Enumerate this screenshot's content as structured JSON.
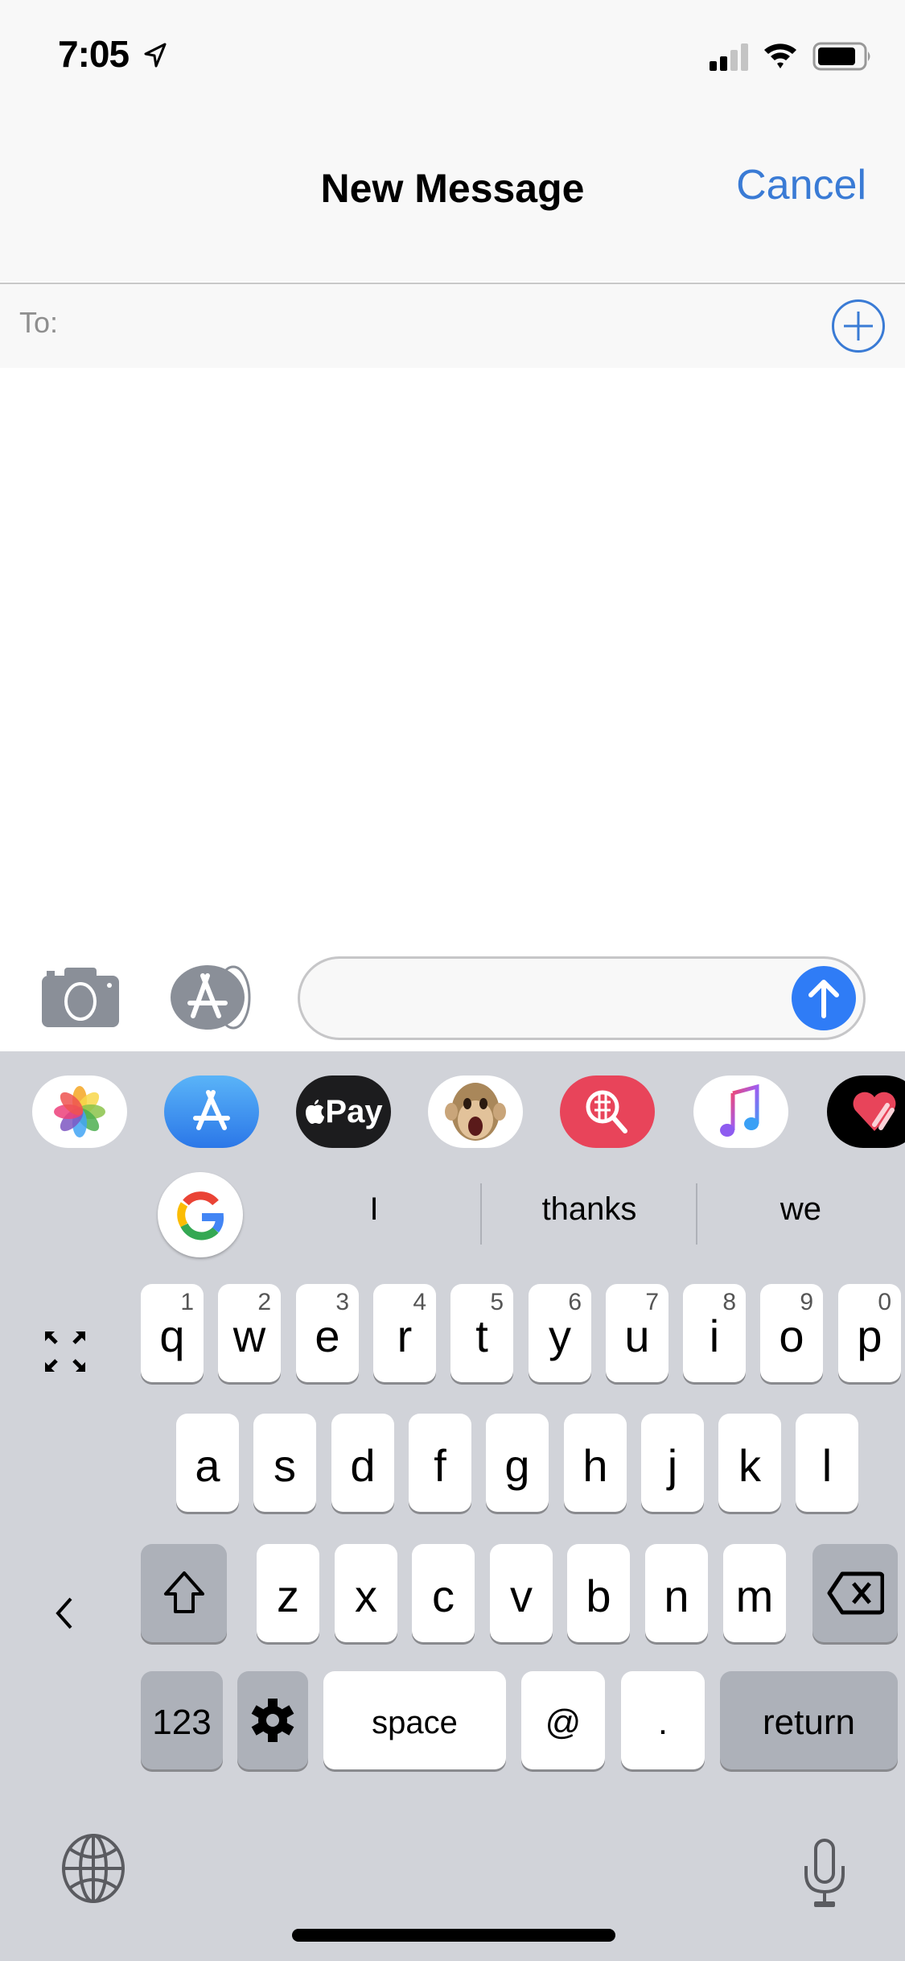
{
  "status_bar": {
    "time": "7:05",
    "location_icon": "location-arrow-icon",
    "signal_icon": "cellular-signal-icon",
    "signal_bars_active": 2,
    "signal_bars_total": 4,
    "wifi_icon": "wifi-icon",
    "battery_icon": "battery-icon",
    "battery_level": 0.8
  },
  "nav": {
    "title": "New Message",
    "cancel_label": "Cancel"
  },
  "to_field": {
    "label": "To:",
    "value": "",
    "add_icon": "plus-circle-icon"
  },
  "compose": {
    "camera_icon": "camera-icon",
    "apps_icon": "app-store-icon",
    "message_value": "",
    "send_icon": "arrow-up-icon"
  },
  "app_drawer": [
    {
      "name": "photos",
      "icon": "photos-icon"
    },
    {
      "name": "app-store",
      "icon": "app-store-icon"
    },
    {
      "name": "apple-pay",
      "icon": "apple-pay-icon",
      "label": "Pay"
    },
    {
      "name": "animoji",
      "icon": "monkey-animoji-icon"
    },
    {
      "name": "image-search",
      "icon": "globe-search-icon"
    },
    {
      "name": "music",
      "icon": "music-note-icon"
    },
    {
      "name": "digital-touch",
      "icon": "heart-touch-icon"
    }
  ],
  "suggestions": {
    "google_icon": "google-g-icon",
    "items": [
      "I",
      "thanks",
      "we"
    ]
  },
  "keyboard": {
    "row1": [
      {
        "key": "q",
        "hint": "1"
      },
      {
        "key": "w",
        "hint": "2"
      },
      {
        "key": "e",
        "hint": "3"
      },
      {
        "key": "r",
        "hint": "4"
      },
      {
        "key": "t",
        "hint": "5"
      },
      {
        "key": "y",
        "hint": "6"
      },
      {
        "key": "u",
        "hint": "7"
      },
      {
        "key": "i",
        "hint": "8"
      },
      {
        "key": "o",
        "hint": "9"
      },
      {
        "key": "p",
        "hint": "0"
      }
    ],
    "row2": [
      "a",
      "s",
      "d",
      "f",
      "g",
      "h",
      "j",
      "k",
      "l"
    ],
    "row3": [
      "z",
      "x",
      "c",
      "v",
      "b",
      "n",
      "m"
    ],
    "numbers_label": "123",
    "space_label": "space",
    "at_label": "@",
    "period_label": ".",
    "return_label": "return",
    "shift_icon": "shift-icon",
    "delete_icon": "backspace-icon",
    "settings_icon": "gear-icon",
    "expand_icon": "expand-arrows-icon",
    "back_icon": "chevron-left-icon",
    "globe_icon": "globe-icon",
    "mic_icon": "microphone-icon"
  }
}
